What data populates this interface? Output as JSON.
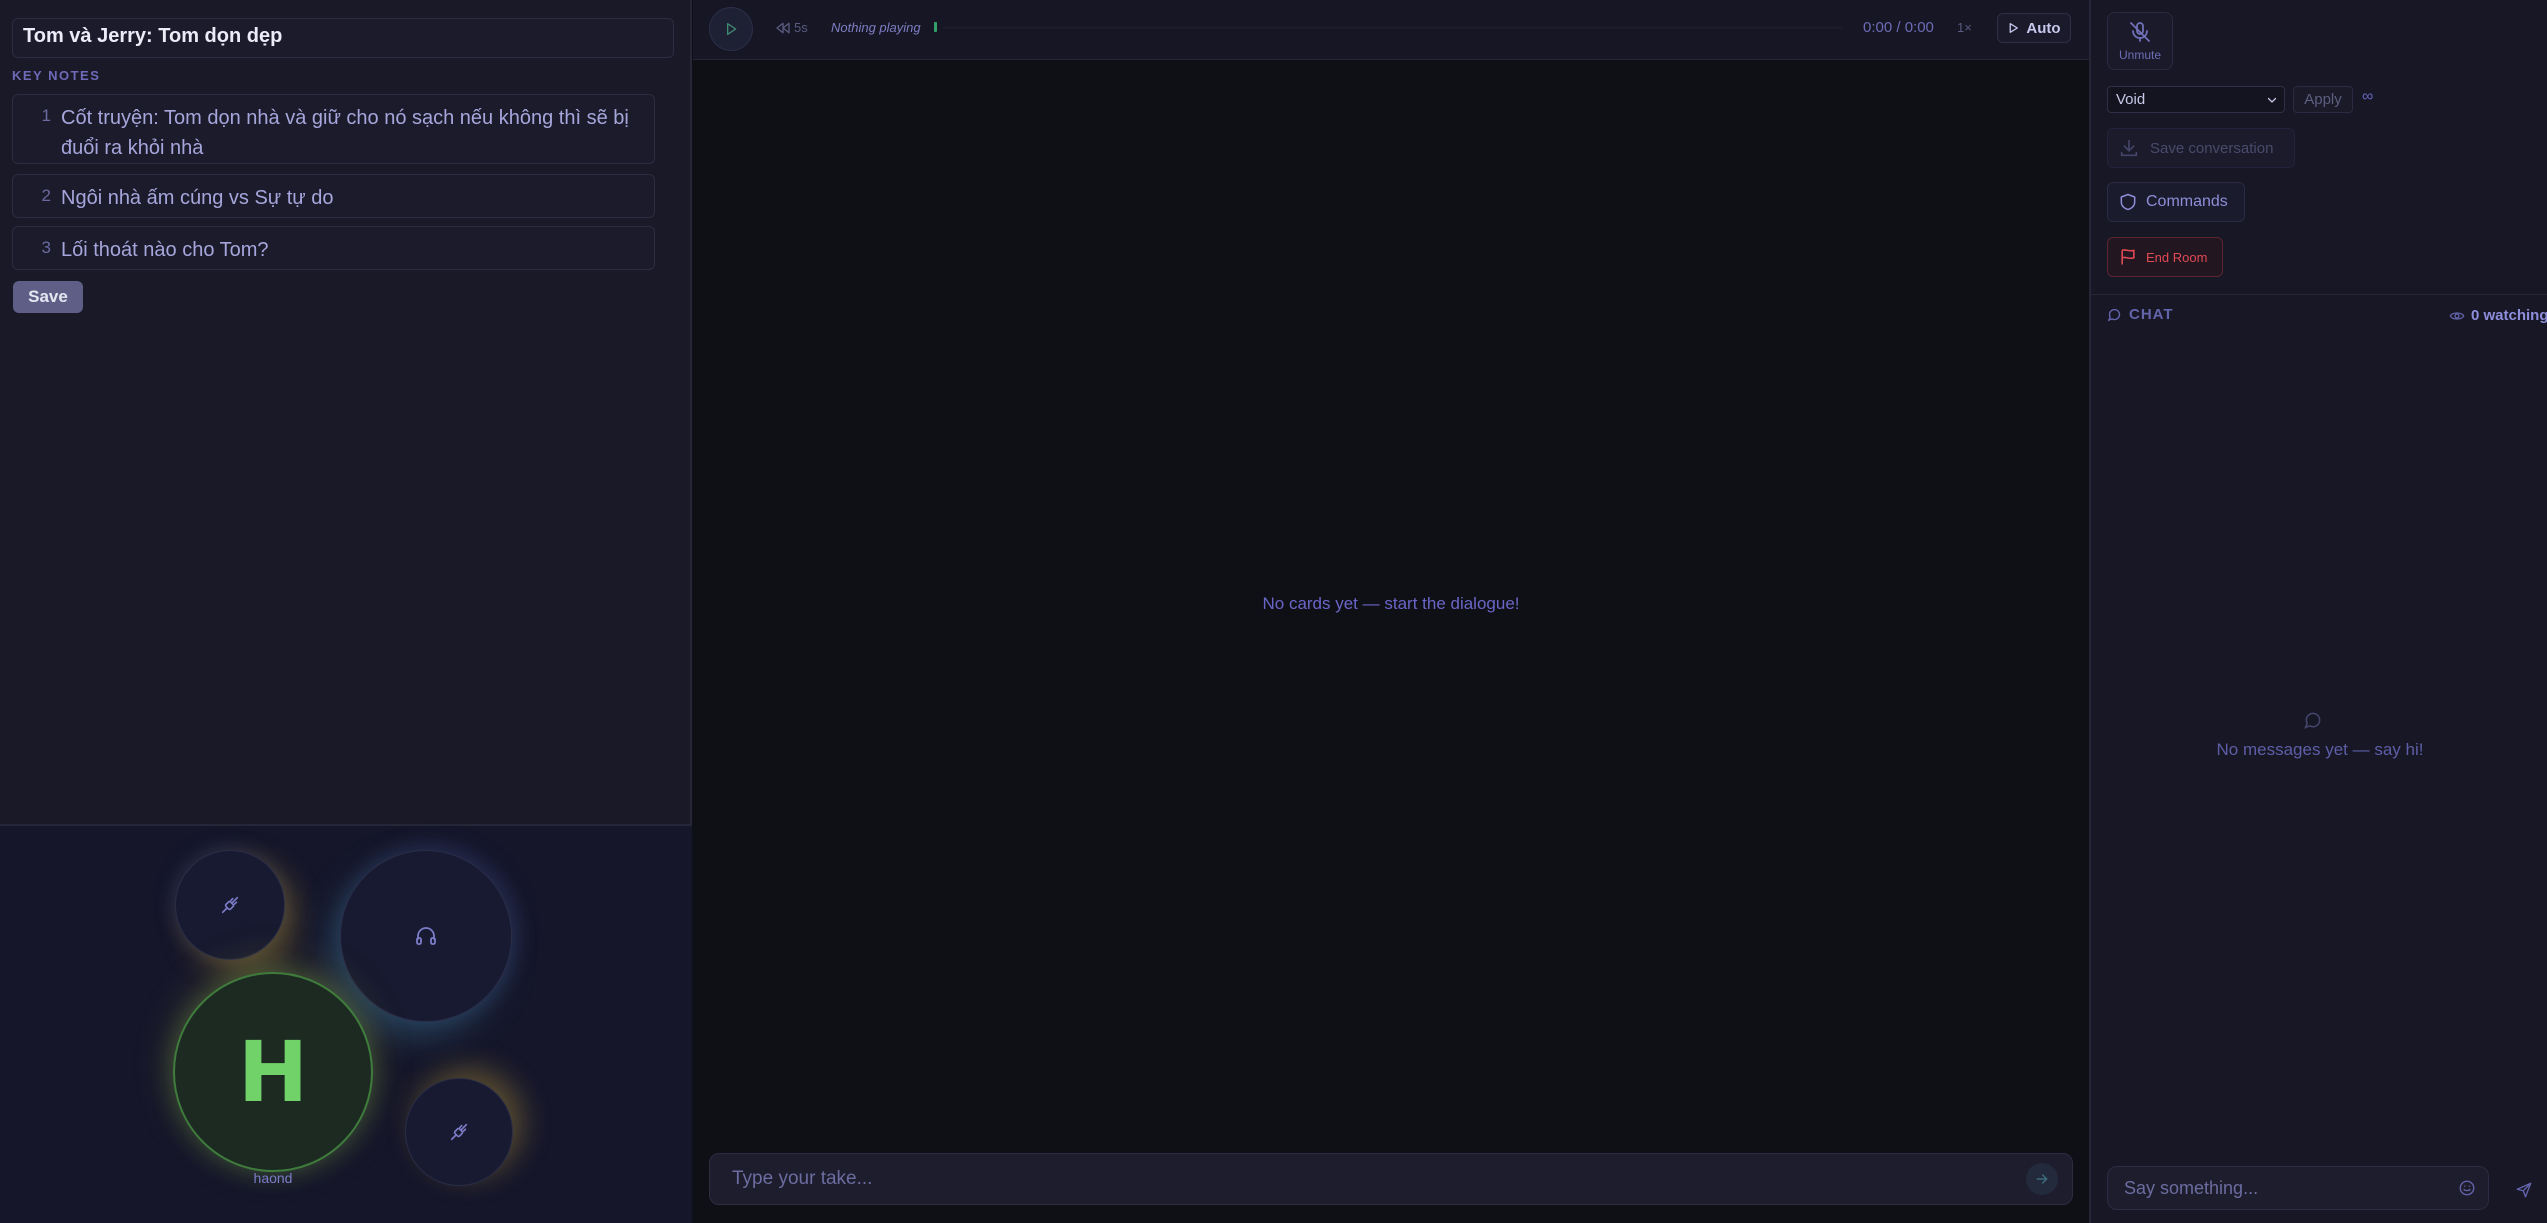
{
  "room": {
    "title": "Tom và Jerry: Tom dọn dẹp"
  },
  "key_notes": {
    "label": "KEY NOTES",
    "items": [
      {
        "num": "1",
        "text": "Cốt truyện: Tom dọn nhà và giữ cho nó sạch nếu không thì sẽ bị đuổi ra khỏi nhà"
      },
      {
        "num": "2",
        "text": "Ngôi nhà ấm cúng vs Sự tự do"
      },
      {
        "num": "3",
        "text": "Lối thoát nào cho Tom?"
      }
    ],
    "save_label": "Save"
  },
  "stage": {
    "seats": [
      {
        "icon": "plug-icon"
      },
      {
        "icon": "headphones-icon"
      },
      {
        "letter": "H",
        "name": "haond"
      },
      {
        "icon": "plug-icon"
      }
    ]
  },
  "player": {
    "rewind_label": "5s",
    "status": "Nothing playing",
    "time": "0:00 / 0:00",
    "speed": "1×",
    "auto_label": "Auto"
  },
  "cards": {
    "empty_text": "No cards yet — start the dialogue!"
  },
  "composer": {
    "placeholder": "Type your take..."
  },
  "controls": {
    "unmute_label": "Unmute",
    "voice_selected": "Void",
    "apply_label": "Apply",
    "infinity": "∞",
    "save_conversation_label": "Save conversation",
    "commands_label": "Commands",
    "end_room_label": "End Room"
  },
  "chat": {
    "header": "CHAT",
    "watching": "0 watching",
    "empty_text": "No messages yet — say hi!",
    "placeholder": "Say something..."
  },
  "colors": {
    "accent": "#7c7cc8",
    "danger": "#e04a55",
    "avatar_green": "#72d26a",
    "progress_green": "#33a06a"
  }
}
